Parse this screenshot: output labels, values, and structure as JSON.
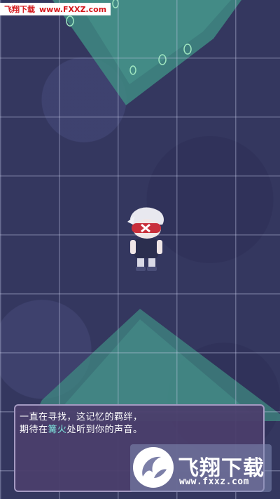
{
  "watermark_top": {
    "site_name": "飞翔下载",
    "url": "www.FXXZ.com"
  },
  "dialog": {
    "line1": "一直在寻找，这记忆的羁绊，",
    "line2_before": "期待在",
    "line2_highlight": "篝火",
    "line2_after": "处听到你的声音。"
  },
  "watermark_logo": {
    "site_name": "飞翔下载",
    "url": "www.fxxz.com"
  },
  "colors": {
    "background": "#34375f",
    "teal": "#3f8f86",
    "dialog_bg": "#4b3e6c",
    "highlight": "#7fe8e0"
  }
}
